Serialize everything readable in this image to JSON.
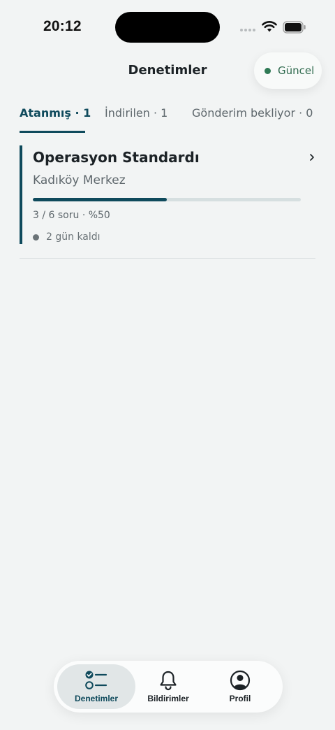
{
  "status_bar": {
    "time": "20:12",
    "icons": [
      "cellular-dots-icon",
      "wifi-icon",
      "battery-icon"
    ]
  },
  "header": {
    "title": "Denetimler",
    "sync_status": {
      "label": "Güncel",
      "dot_color": "#2f7a55"
    }
  },
  "tabs": [
    {
      "label": "Atanmış · 1",
      "active": true
    },
    {
      "label": "İndirilen · 1",
      "active": false
    },
    {
      "label": "Gönderim bekliyor · 0",
      "active": false
    }
  ],
  "audits": [
    {
      "title": "Operasyon Standardı",
      "location": "Kadıköy Merkez",
      "progress_text": "3 / 6 soru · %50",
      "progress_fraction": 0.5,
      "deadline": "2 gün kaldı"
    }
  ],
  "bottom_nav": {
    "items": [
      {
        "label": "Denetimler",
        "icon": "checklist-icon",
        "active": true
      },
      {
        "label": "Bildirimler",
        "icon": "bell-icon",
        "active": false
      },
      {
        "label": "Profil",
        "icon": "profile-icon",
        "active": false
      }
    ]
  },
  "colors": {
    "accent": "#0f4a5c",
    "background": "#f2f4f4",
    "success": "#2f7a55"
  }
}
